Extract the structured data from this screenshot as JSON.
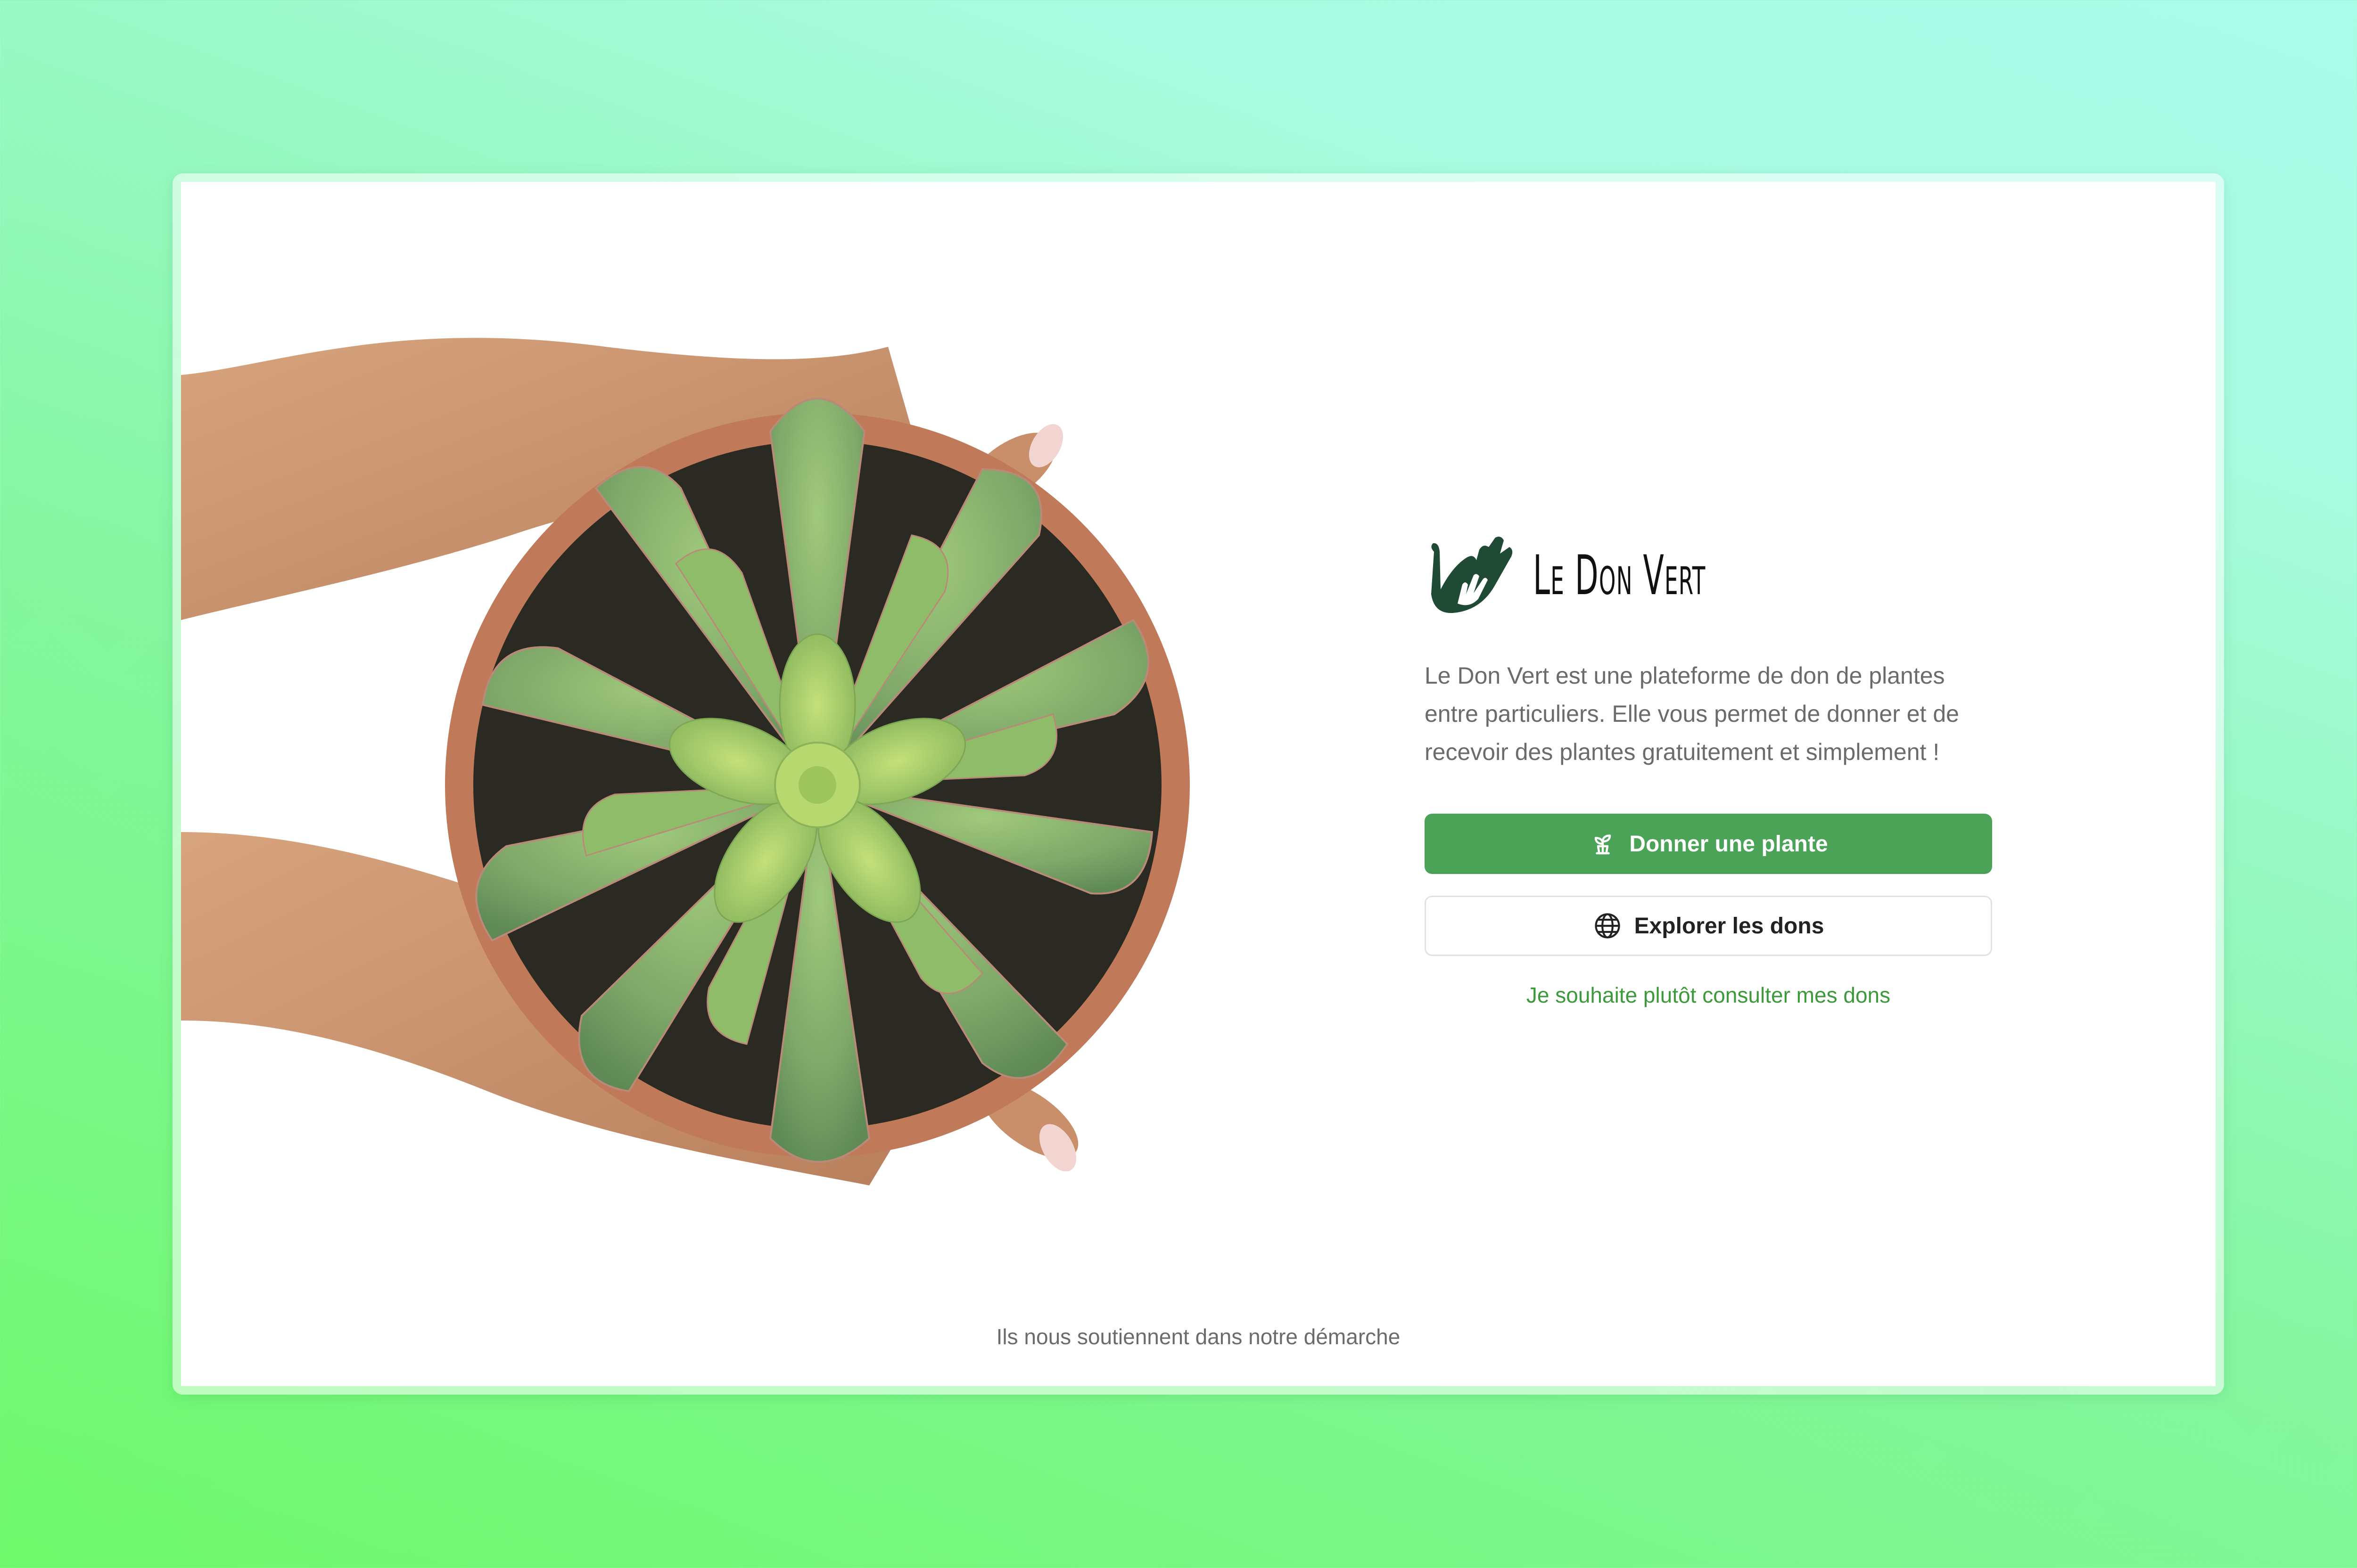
{
  "brand": {
    "name": "Le Don Vert",
    "logo_icon": "hands-icon",
    "logo_color": "#1f4a33"
  },
  "hero": {
    "image_icon": "succulent-in-hands-image"
  },
  "intro": {
    "description": "Le Don Vert est une plateforme de don de plantes entre particuliers. Elle vous permet de donner et de recevoir des plantes gratuitement et simplement !"
  },
  "actions": {
    "donate_label": "Donner une plante",
    "donate_icon": "sprout-icon",
    "explore_label": "Explorer les dons",
    "explore_icon": "globe-icon",
    "my_donations_link": "Je souhaite plutôt consulter mes dons"
  },
  "footer": {
    "supporters_text": "Ils nous soutiennent dans notre démarche"
  },
  "colors": {
    "primary": "#4aa356",
    "link": "#3d9a3b",
    "text_muted": "#6b6b6b"
  }
}
